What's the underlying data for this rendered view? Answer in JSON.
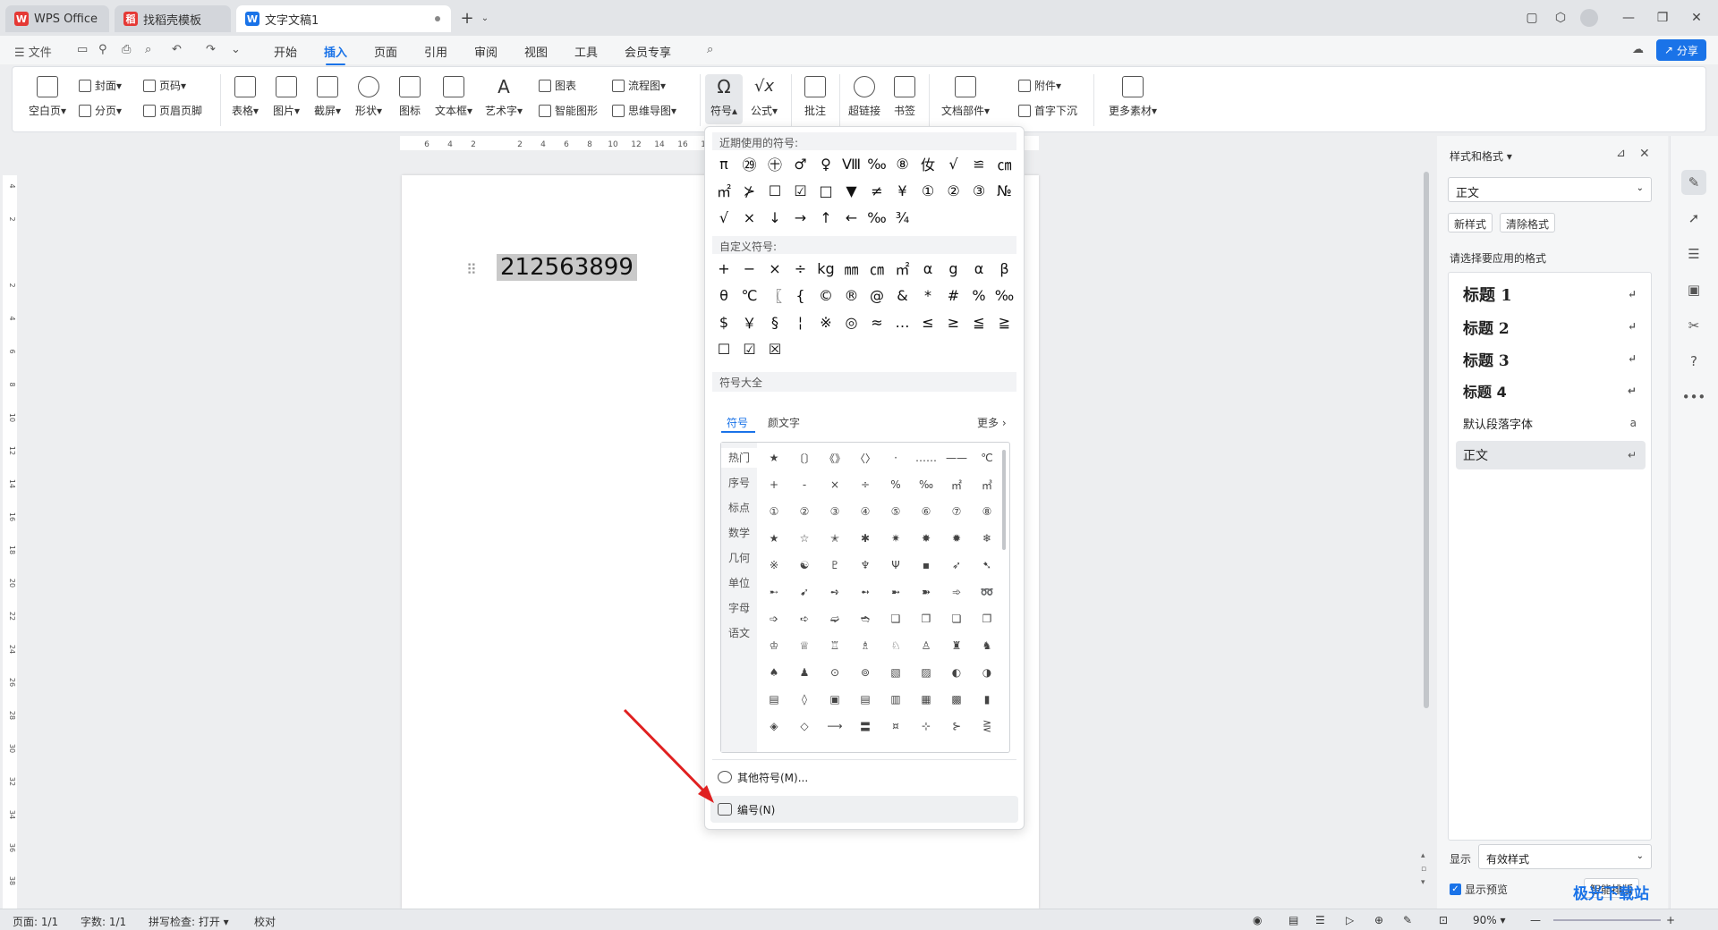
{
  "titlebar": {
    "tabs": [
      {
        "label": "WPS Office",
        "icon": "W"
      },
      {
        "label": "找稻壳模板",
        "icon": "稻"
      },
      {
        "label": "文字文稿1",
        "icon": "W"
      }
    ],
    "new_tab": "+"
  },
  "menubar": {
    "file": "文件",
    "items": [
      "开始",
      "插入",
      "页面",
      "引用",
      "审阅",
      "视图",
      "工具",
      "会员专享"
    ],
    "active": "插入",
    "share": "分享"
  },
  "ribbon": {
    "big": [
      {
        "label": "空白页",
        "dd": true
      },
      {
        "label": "表格",
        "dd": true
      },
      {
        "label": "图片",
        "dd": true
      },
      {
        "label": "截屏",
        "dd": true
      },
      {
        "label": "形状",
        "dd": true
      },
      {
        "label": "图标",
        "dd": false
      },
      {
        "label": "文本框",
        "dd": true
      },
      {
        "label": "艺术字",
        "dd": true
      },
      {
        "label": "符号",
        "dd": true
      },
      {
        "label": "公式",
        "dd": true
      },
      {
        "label": "批注",
        "dd": false
      },
      {
        "label": "超链接",
        "dd": false
      },
      {
        "label": "书签",
        "dd": false
      },
      {
        "label": "文档部件",
        "dd": true
      },
      {
        "label": "更多素材",
        "dd": true
      }
    ],
    "small": [
      "封面",
      "分页",
      "页码",
      "页眉页脚",
      "图表",
      "智能图形",
      "流程图",
      "思维导图",
      "附件",
      "首字下沉"
    ]
  },
  "ruler": {
    "ticks": [
      "6",
      "4",
      "2",
      "",
      "2",
      "4",
      "6",
      "8",
      "10",
      "12",
      "14",
      "16",
      "18"
    ]
  },
  "vruler": {
    "ticks": [
      "4",
      "2",
      "",
      "2",
      "4",
      "6",
      "8",
      "10",
      "12",
      "14",
      "16",
      "18",
      "20",
      "22",
      "24",
      "26",
      "28",
      "30",
      "32",
      "34",
      "36",
      "38"
    ]
  },
  "document": {
    "text": "212563899"
  },
  "symbol_menu": {
    "recent_header": "近期使用的符号:",
    "recent": [
      "π",
      "㉙",
      "㊉",
      "♂",
      "♀",
      "Ⅷ",
      "‰",
      "⑧",
      "㚢",
      "√",
      "≌",
      "㎝",
      "㎡",
      "⊁",
      "☐",
      "☑",
      "□",
      "▼",
      "≠",
      "¥",
      "①",
      "②",
      "③",
      "№",
      "√",
      "×",
      "↓",
      "→",
      "↑",
      "←",
      "‰",
      "¾"
    ],
    "custom_header": "自定义符号:",
    "custom": [
      "+",
      "−",
      "×",
      "÷",
      "kg",
      "㎜",
      "㎝",
      "㎡",
      "α",
      "g",
      "α",
      "β",
      "θ",
      "℃",
      "〖",
      "{",
      "©",
      "®",
      "@",
      "&",
      "*",
      "#",
      "%",
      "‰",
      "$",
      "￥",
      "§",
      "¦",
      "※",
      "◎",
      "≈",
      "…",
      "≤",
      "≥",
      "≦",
      "≧",
      "☐",
      "☑",
      "☒"
    ],
    "all_header": "符号大全",
    "subtabs": [
      "符号",
      "颜文字"
    ],
    "more": "更多",
    "categories": [
      "热门",
      "序号",
      "标点",
      "数学",
      "几何",
      "单位",
      "字母",
      "语文"
    ],
    "grid": [
      "★",
      "〔〕",
      "《》",
      "〈〉",
      "·",
      "……",
      "——",
      "℃",
      "+",
      "-",
      "×",
      "÷",
      "%",
      "‰",
      "㎡",
      "㎥",
      "①",
      "②",
      "③",
      "④",
      "⑤",
      "⑥",
      "⑦",
      "⑧",
      "★",
      "☆",
      "✭",
      "✱",
      "✷",
      "✸",
      "✹",
      "❄",
      "※",
      "☯",
      "♇",
      "♆",
      "Ψ",
      "▪",
      "➶",
      "➷",
      "➸",
      "➹",
      "➺",
      "➻",
      "➼",
      "➽",
      "➾",
      "➿",
      "➩",
      "➪",
      "➫",
      "➬",
      "❑",
      "❒",
      "❏",
      "❐",
      "♔",
      "♕",
      "♖",
      "♗",
      "♘",
      "♙",
      "♜",
      "♞",
      "♠",
      "♟",
      "⊙",
      "⊚",
      "▧",
      "▨",
      "◐",
      "◑",
      "▤",
      "◊",
      "▣",
      "▤",
      "▥",
      "▦",
      "▩",
      "▮",
      "◈",
      "◇",
      "⟶",
      "〓",
      "¤",
      "⊹",
      "⊱",
      "⋛"
    ],
    "items": [
      "其他符号(M)...",
      "编号(N)"
    ]
  },
  "right_panel": {
    "title": "样式和格式",
    "current_style": "正文",
    "new_style": "新样式",
    "clear_format": "清除格式",
    "choose_label": "请选择要应用的格式",
    "styles": [
      "标题  1",
      "标题  2",
      "标题  3",
      "标题 4",
      "默认段落字体",
      "正文"
    ],
    "show_label": "显示",
    "show_value": "有效样式",
    "preview_label": "显示预览",
    "smart_btn": "智能排版"
  },
  "statusbar": {
    "page": "页面: 1/1",
    "words": "字数: 1/1",
    "spell": "拼写检查: 打开",
    "proof": "校对",
    "zoom": "90%"
  },
  "watermark": "极光下载站"
}
